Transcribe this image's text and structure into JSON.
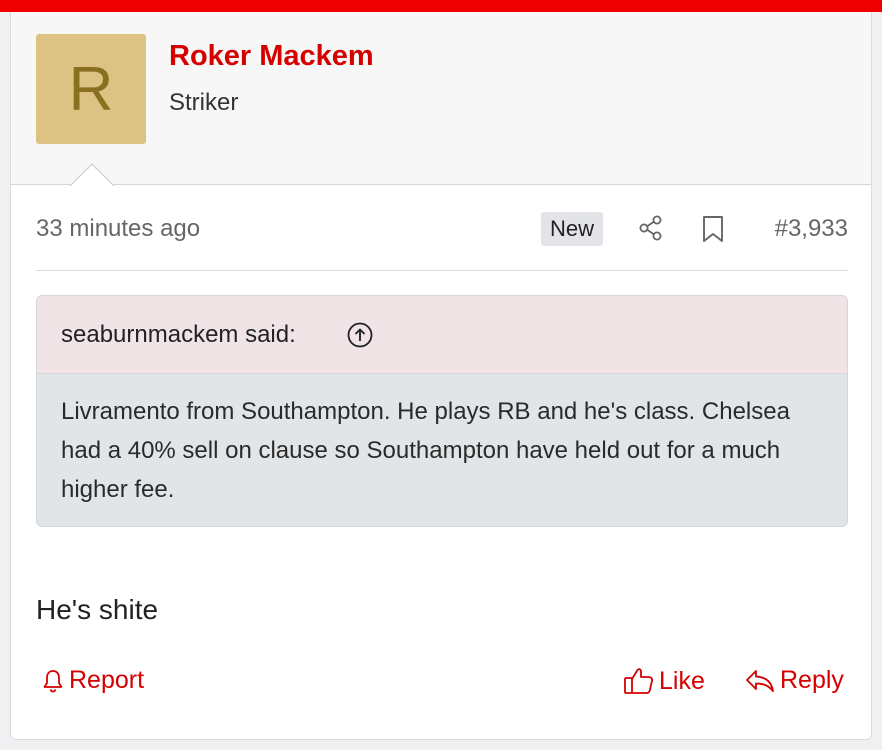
{
  "colors": {
    "accent": "#d50000",
    "top_bar": "#ee0000",
    "avatar_bg": "#dcc383",
    "avatar_letter": "#8a6f20",
    "username": "#d50000"
  },
  "user": {
    "avatar_letter": "R",
    "name": "Roker Mackem",
    "title": "Striker"
  },
  "meta": {
    "timestamp": "33 minutes ago",
    "badge": "New",
    "post_number": "#3,933",
    "icons": [
      "share-icon",
      "bookmark-icon"
    ]
  },
  "quote": {
    "author": "seaburnmackem said:",
    "icon": "arrow-up-circle-icon",
    "text": "Livramento from Southampton. He plays RB and he's class. Chelsea had a 40% sell on clause so Southampton have held out for a much higher fee."
  },
  "post": {
    "text": "He's shite"
  },
  "actions": {
    "report": "Report",
    "like": "Like",
    "reply": "Reply"
  }
}
